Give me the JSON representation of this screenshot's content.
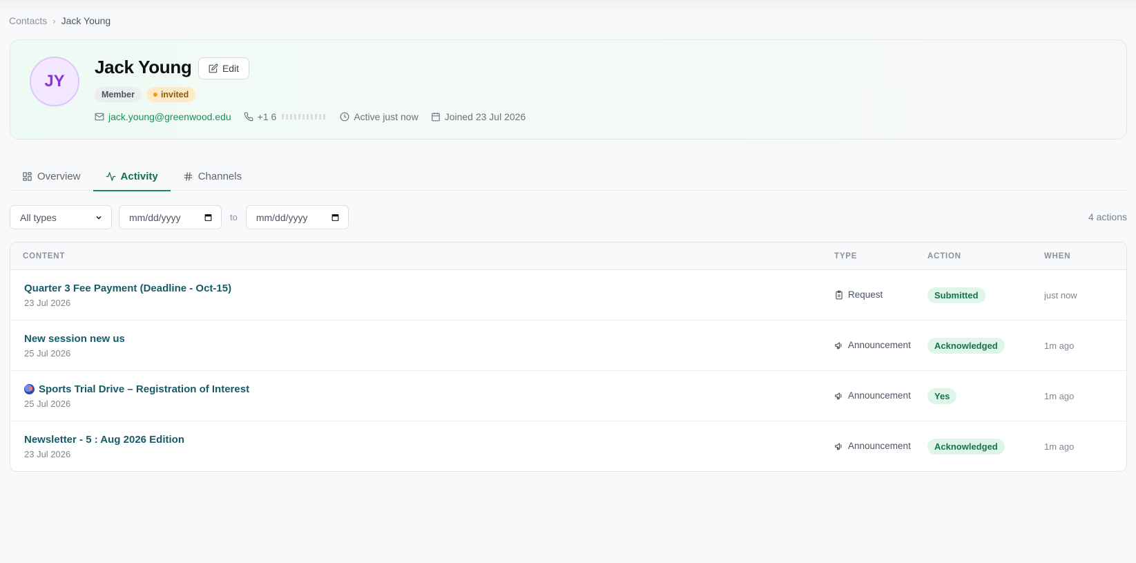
{
  "breadcrumb": {
    "parent": "Contacts",
    "separator": "›",
    "current": "Jack Young"
  },
  "profile": {
    "initials": "JY",
    "name": "Jack Young",
    "edit_label": "Edit",
    "role_badge": "Member",
    "status_badge": "invited",
    "email": "jack.young@greenwood.edu",
    "phone_prefix": "+1 6",
    "activity": "Active just now",
    "joined": "Joined 23 Jul 2026"
  },
  "tabs": [
    {
      "label": "Overview",
      "icon": "grid-icon"
    },
    {
      "label": "Activity",
      "icon": "activity-icon",
      "active": true
    },
    {
      "label": "Channels",
      "icon": "hash-icon"
    }
  ],
  "filters": {
    "type_select": "All types",
    "date_from_placeholder": "mm/dd/yyyy",
    "to_label": "to",
    "date_to_placeholder": "mm/dd/yyyy",
    "count": "4 actions"
  },
  "table": {
    "headers": {
      "content": "CONTENT",
      "type": "TYPE",
      "action": "ACTION",
      "when": "WHEN"
    },
    "rows": [
      {
        "title": "Quarter 3 Fee Payment (Deadline - Oct-15)",
        "date": "23 Jul 2026",
        "type": "Request",
        "type_icon": "clipboard-icon",
        "action": "Submitted",
        "when": "just now"
      },
      {
        "title": "New session new us",
        "date": "25 Jul 2026",
        "type": "Announcement",
        "type_icon": "megaphone-icon",
        "action": "Acknowledged",
        "when": "1m ago"
      },
      {
        "title": "Sports Trial Drive – Registration of Interest",
        "date": "25 Jul 2026",
        "type": "Announcement",
        "type_icon": "megaphone-icon",
        "action": "Yes",
        "when": "1m ago",
        "emoji": "globe-icon"
      },
      {
        "title": "Newsletter - 5 : Aug 2026 Edition",
        "date": "23 Jul 2026",
        "type": "Announcement",
        "type_icon": "megaphone-icon",
        "action": "Acknowledged",
        "when": "1m ago"
      }
    ]
  },
  "colors": {
    "accent": "#1a8a5c",
    "link": "#155b6a",
    "avatar_text": "#8b36d9",
    "invited_dot": "#f39c12"
  }
}
